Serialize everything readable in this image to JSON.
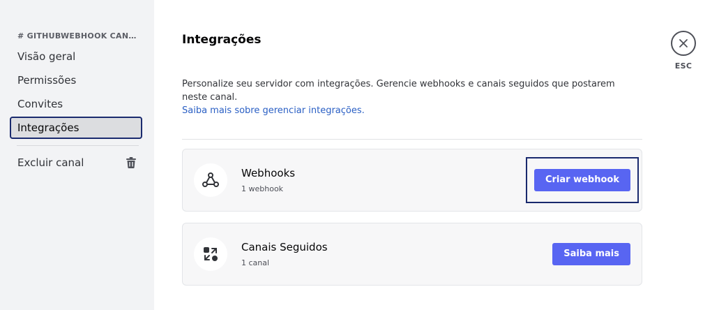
{
  "sidebar": {
    "header": "# GITHUBWEBHOOK CANAI...",
    "items": [
      {
        "label": "Visão geral"
      },
      {
        "label": "Permissões"
      },
      {
        "label": "Convites"
      },
      {
        "label": "Integrações"
      }
    ],
    "delete_label": "Excluir canal"
  },
  "main": {
    "title": "Integrações",
    "description": "Personalize seu servidor com integrações. Gerencie webhooks e canais seguidos que postarem neste canal.",
    "learn_link": "Saiba mais sobre gerenciar integrações.",
    "cards": [
      {
        "title": "Webhooks",
        "subtitle": "1 webhook",
        "button": "Criar webhook",
        "icon": "webhook-icon"
      },
      {
        "title": "Canais Seguidos",
        "subtitle": "1 canal",
        "button": "Saiba mais",
        "icon": "followed-channels-icon"
      }
    ]
  },
  "close": {
    "label": "ESC"
  },
  "colors": {
    "accent": "#5865f2",
    "link": "#2a5fc4",
    "focus": "#1a2a6e"
  }
}
